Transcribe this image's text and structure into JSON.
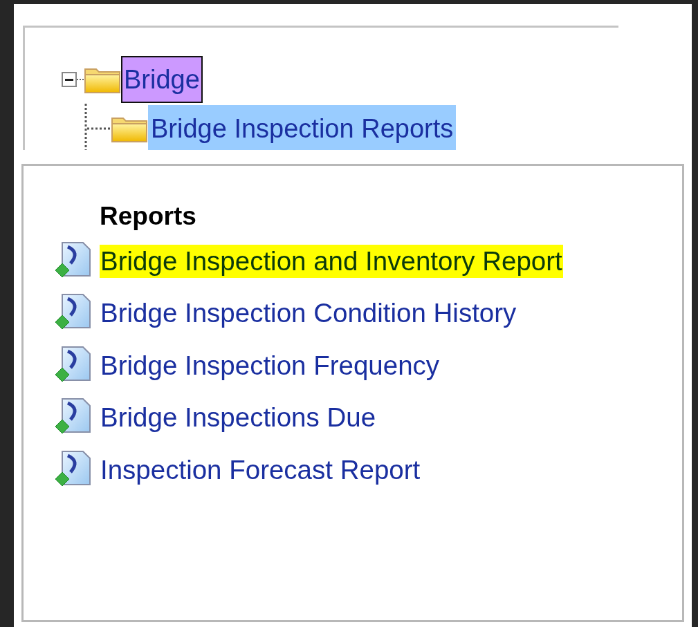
{
  "tree": [
    {
      "label": "Bridge",
      "expanded": true,
      "focused": true,
      "selected": false,
      "children": [
        {
          "label": "Bridge Inspection Reports",
          "focused": false,
          "selected": true
        }
      ]
    }
  ],
  "reports": {
    "heading": "Reports",
    "items": [
      {
        "label": "Bridge Inspection and Inventory Report",
        "highlighted": true
      },
      {
        "label": "Bridge Inspection Condition History",
        "highlighted": false
      },
      {
        "label": "Bridge Inspection Frequency",
        "highlighted": false
      },
      {
        "label": "Bridge Inspections Due",
        "highlighted": false
      },
      {
        "label": "Inspection Forecast Report",
        "highlighted": false
      }
    ]
  }
}
